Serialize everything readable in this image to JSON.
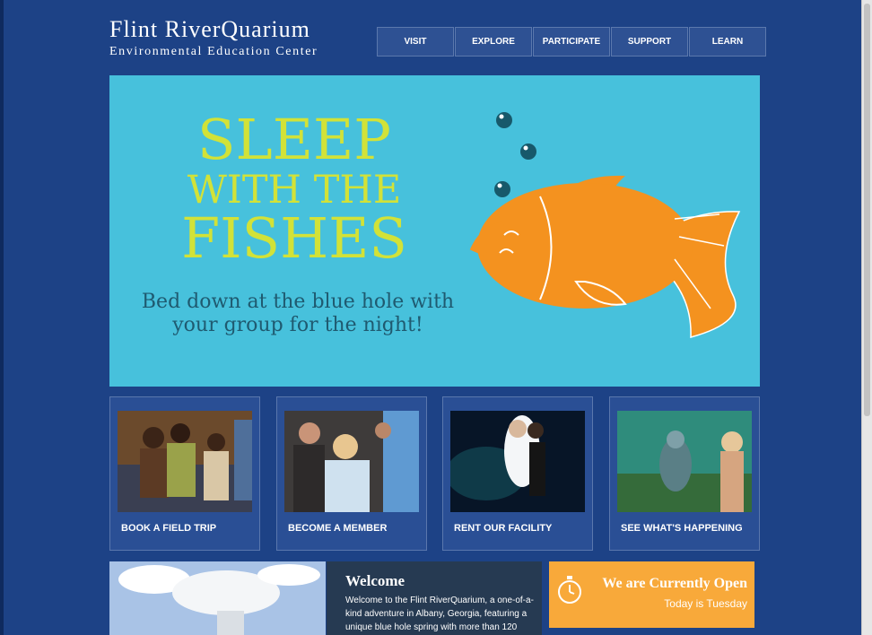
{
  "logo": {
    "line1": "Flint RiverQuarium",
    "line2": "Environmental Education Center"
  },
  "nav": [
    {
      "label": "VISIT"
    },
    {
      "label": "EXPLORE"
    },
    {
      "label": "PARTICIPATE"
    },
    {
      "label": "SUPPORT"
    },
    {
      "label": "LEARN"
    }
  ],
  "hero": {
    "line1": "SLEEP",
    "line2": "WITH THE",
    "line3": "FISHES",
    "subtitle": "Bed down at the blue hole with your group for the night!"
  },
  "tiles": [
    {
      "label": "BOOK A FIELD TRIP"
    },
    {
      "label": "BECOME A MEMBER"
    },
    {
      "label": "RENT OUR FACILITY"
    },
    {
      "label": "SEE WHAT'S HAPPENING"
    }
  ],
  "welcome": {
    "title": "Welcome",
    "body": "Welcome to the Flint RiverQuarium, a one-of-a-kind adventure in Albany, Georgia, featuring a unique blue hole spring with more than 120"
  },
  "hours": {
    "title": "We are Currently Open",
    "subtitle": "Today is Tuesday"
  },
  "colors": {
    "background": "#1d4286",
    "hero_bg": "#47c1dc",
    "hero_title": "#d2e238",
    "fish": "#f4921f",
    "open_box": "#f8a93a",
    "welcome_box": "#263a52"
  }
}
